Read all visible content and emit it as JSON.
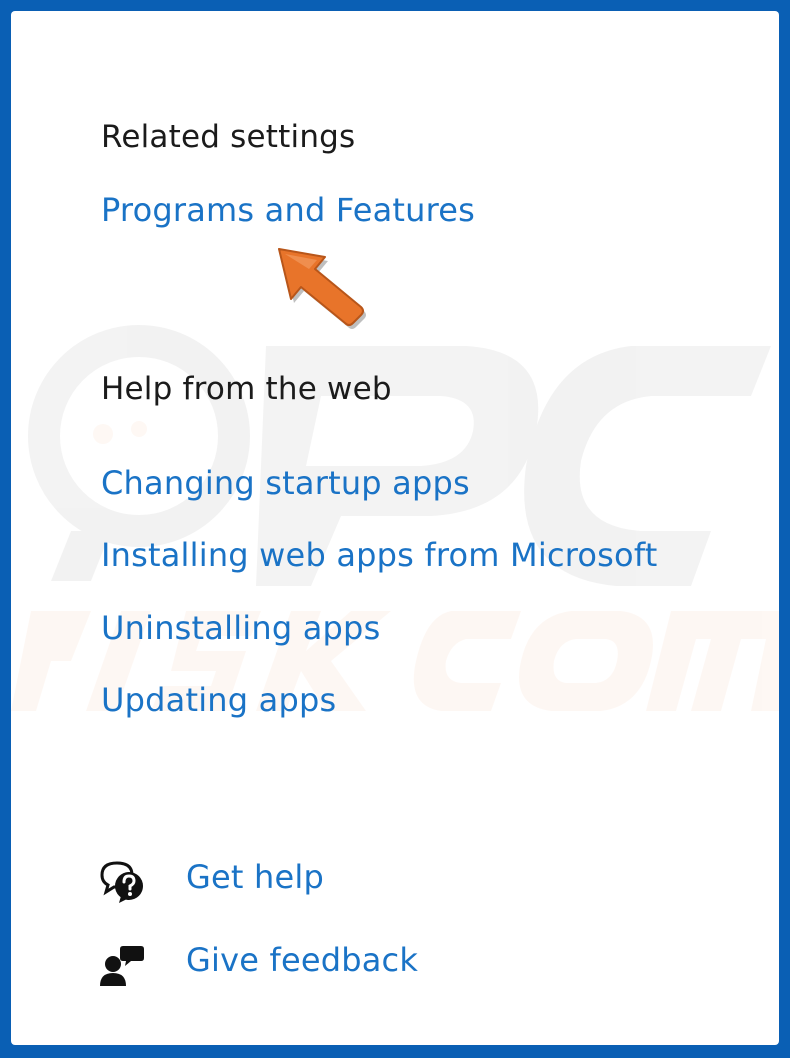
{
  "related_settings": {
    "heading": "Related settings",
    "programs_link": "Programs and Features"
  },
  "help_web": {
    "heading": "Help from the web",
    "links": [
      "Changing startup apps",
      "Installing web apps from Microsoft",
      "Uninstalling apps",
      "Updating apps"
    ]
  },
  "footer": {
    "get_help": "Get help",
    "give_feedback": "Give feedback"
  },
  "colors": {
    "border": "#0a5fb4",
    "link": "#1a73c6",
    "arrow": "#e8742a"
  }
}
